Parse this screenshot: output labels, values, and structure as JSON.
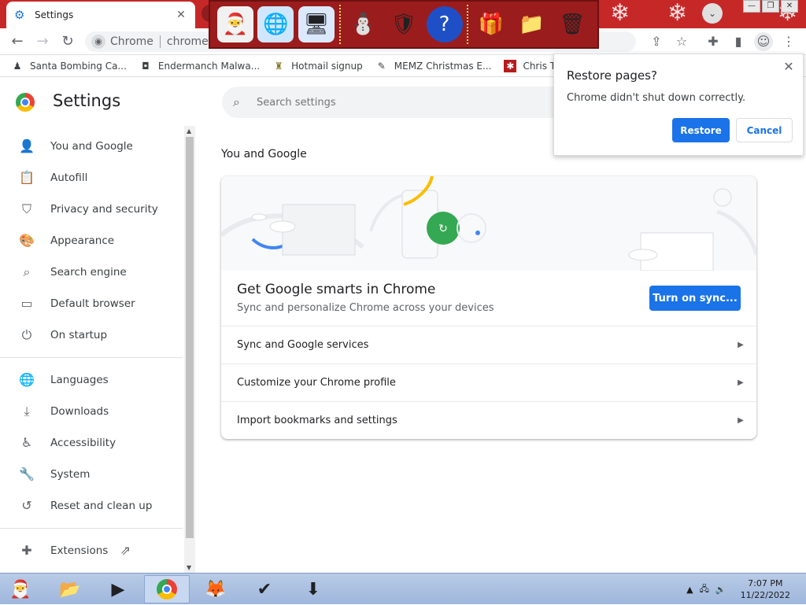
{
  "window": {
    "tab_title": "Settings",
    "tab_close": "✕",
    "controls": {
      "minimize": "—",
      "restore": "❐",
      "close": "✕"
    }
  },
  "addressbar": {
    "site_label": "Chrome",
    "url": "chrome://settings"
  },
  "bookmarks": [
    {
      "label": "Santa Bombing Ca...",
      "icon": "santa-icon"
    },
    {
      "label": "Endermanch Malwa...",
      "icon": "enderman-icon"
    },
    {
      "label": "Hotmail signup",
      "icon": "trophy-icon"
    },
    {
      "label": "MEMZ Christmas E...",
      "icon": "memz-icon"
    },
    {
      "label": "Chris Tracker",
      "icon": "star-icon"
    }
  ],
  "settings": {
    "title": "Settings",
    "search_placeholder": "Search settings",
    "sidebar": [
      {
        "label": "You and Google",
        "icon": "person-icon"
      },
      {
        "label": "Autofill",
        "icon": "clipboard-icon"
      },
      {
        "label": "Privacy and security",
        "icon": "shield-icon"
      },
      {
        "label": "Appearance",
        "icon": "palette-icon"
      },
      {
        "label": "Search engine",
        "icon": "search-icon"
      },
      {
        "label": "Default browser",
        "icon": "browser-icon"
      },
      {
        "label": "On startup",
        "icon": "power-icon"
      },
      {
        "label": "Languages",
        "icon": "globe-icon"
      },
      {
        "label": "Downloads",
        "icon": "download-icon"
      },
      {
        "label": "Accessibility",
        "icon": "accessibility-icon"
      },
      {
        "label": "System",
        "icon": "wrench-icon"
      },
      {
        "label": "Reset and clean up",
        "icon": "history-icon"
      },
      {
        "label": "Extensions",
        "icon": "puzzle-icon"
      }
    ],
    "section_title": "You and Google",
    "sync": {
      "title": "Get Google smarts in Chrome",
      "subtitle": "Sync and personalize Chrome across your devices",
      "button": "Turn on sync..."
    },
    "rows": [
      {
        "label": "Sync and Google services"
      },
      {
        "label": "Customize your Chrome profile"
      },
      {
        "label": "Import bookmarks and settings"
      }
    ]
  },
  "dialog": {
    "title": "Restore pages?",
    "message": "Chrome didn't shut down correctly.",
    "restore": "Restore",
    "cancel": "Cancel"
  },
  "taskbar": {
    "time": "7:07 PM",
    "date": "11/22/2022"
  },
  "colors": {
    "accent": "#1a73e8",
    "titlebar": "#c62828",
    "taskbar": "#b8cbe6"
  }
}
